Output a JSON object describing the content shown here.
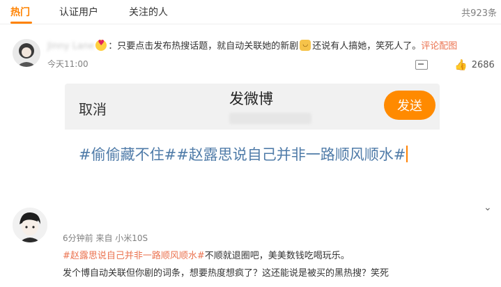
{
  "tabs": [
    {
      "label": "热门"
    },
    {
      "label": "认证用户"
    },
    {
      "label": "关注的人"
    }
  ],
  "total_count": "共923条",
  "comment1": {
    "username": "Jinny Lane",
    "text_part1": "：只要点击发布热搜话题，就自动关联她的新剧",
    "text_part2": "还说有人搞她，笑死人了。",
    "image_link": "评论配图",
    "time": "今天11:00",
    "likes": "2686"
  },
  "compose": {
    "cancel_label": "取消",
    "title": "发微博",
    "send_label": "发送",
    "text": "#偷偷藏不住##赵露思说自己并非一路顺风顺水#"
  },
  "comment2": {
    "meta": "6分钟前  来自 小米10S",
    "hashtag": "#赵露思说自己并非一路顺风顺水#",
    "text_line1": "不顺就退圈吧，美美数钱吃喝玩乐。",
    "text_line2": "发个博自动关联但你剧的词条，想要热度想疯了？这还能说是被买的黑热搜？笑死"
  },
  "colors": {
    "accent": "#ff8200",
    "link": "#eb7350",
    "send_button": "#ff8a00",
    "compose_text": "#4f7ba8"
  },
  "icons": [
    "comment-icon",
    "thumbs-up-icon",
    "chevron-down-icon"
  ]
}
